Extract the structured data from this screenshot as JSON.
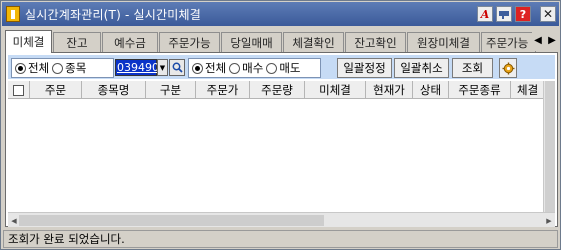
{
  "window": {
    "title": "실시간계좌관리(T) - 실시간미체결",
    "buttons": {
      "a": "A",
      "q": "?",
      "x": "✕"
    }
  },
  "tabs": [
    {
      "label": "미체결",
      "active": true
    },
    {
      "label": "잔고"
    },
    {
      "label": "예수금"
    },
    {
      "label": "주문가능"
    },
    {
      "label": "당일매매"
    },
    {
      "label": "체결확인"
    },
    {
      "label": "잔고확인"
    },
    {
      "label": "원장미체결"
    },
    {
      "label": "주문가능"
    }
  ],
  "filter": {
    "scope": {
      "options": [
        "전체",
        "종목"
      ],
      "selected": "전체"
    },
    "code": "039490",
    "side": {
      "options": [
        "전체",
        "매수",
        "매도"
      ],
      "selected": "전체"
    }
  },
  "actions": {
    "bulk_modify": "일괄정정",
    "bulk_cancel": "일괄취소",
    "query": "조회"
  },
  "grid": {
    "columns": [
      "주문",
      "종목명",
      "구분",
      "주문가",
      "주문량",
      "미체결",
      "현재가",
      "상태",
      "주문종류",
      "체결"
    ],
    "rows": []
  },
  "status": {
    "message": "조회가 완료 되었습니다."
  },
  "colors": {
    "titlebar": "#3b5a99",
    "toolbar": "#c6dbf5",
    "code_highlight": "#0a33c8"
  }
}
